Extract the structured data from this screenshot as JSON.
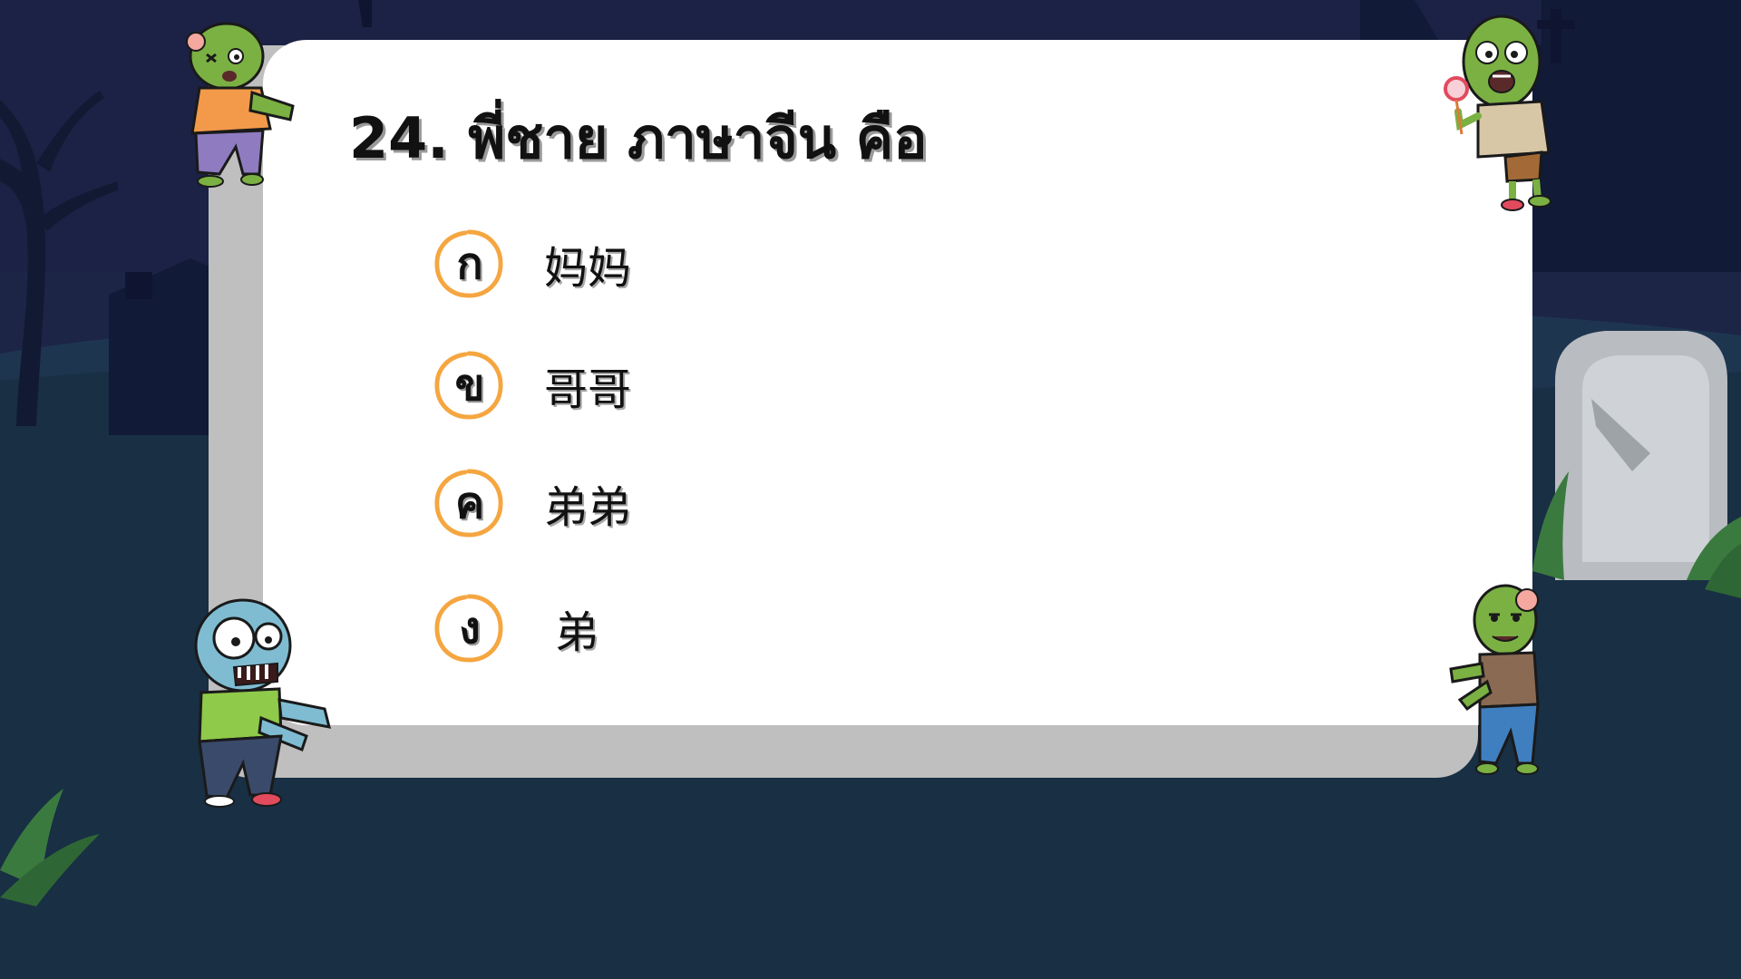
{
  "question": {
    "text": "24.  พี่ชาย ภาษาจีน คือ"
  },
  "options": [
    {
      "letter": "ก",
      "text": "妈妈"
    },
    {
      "letter": "ข",
      "text": "哥哥"
    },
    {
      "letter": "ค",
      "text": "弟弟"
    },
    {
      "letter": "ง",
      "text": "弟"
    }
  ],
  "colors": {
    "sky": "#1d2547",
    "ground": "#182f44",
    "card": "#ffffff",
    "card_shadow": "#bfbfbf",
    "option_ring": "#f5a640",
    "text": "#111111"
  },
  "icons": {
    "zombie_top_left": "zombie-orange-shirt-icon",
    "zombie_top_right": "zombie-lollipop-icon",
    "zombie_bottom_left": "zombie-blue-big-eyes-icon",
    "zombie_bottom_right": "zombie-brown-shirt-icon",
    "option_marker": "orange-ring-icon"
  }
}
